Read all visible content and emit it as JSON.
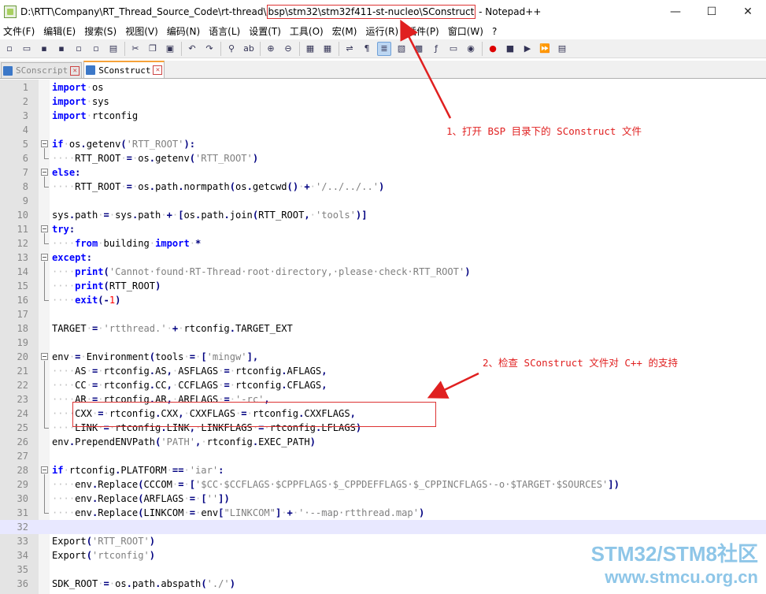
{
  "window": {
    "title_prefix": "D:\\RTT\\Company\\RT_Thread_Source_Code\\rt-thread\\",
    "title_highlight": "bsp\\stm32\\stm32f411-st-nucleo\\SConstruct",
    "title_suffix": " - Notepad++",
    "minimize": "—",
    "maximize": "☐",
    "close": "✕"
  },
  "menu": [
    "文件(F)",
    "编辑(E)",
    "搜索(S)",
    "视图(V)",
    "编码(N)",
    "语言(L)",
    "设置(T)",
    "工具(O)",
    "宏(M)",
    "运行(R)",
    "插件(P)",
    "窗口(W)",
    "?"
  ],
  "tabs": [
    {
      "label": "SConscript",
      "active": false
    },
    {
      "label": "SConstruct",
      "active": true
    }
  ],
  "code_lines": [
    "import os",
    "import sys",
    "import rtconfig",
    "",
    "if os.getenv('RTT_ROOT'):",
    "    RTT_ROOT = os.getenv('RTT_ROOT')",
    "else:",
    "    RTT_ROOT = os.path.normpath(os.getcwd() + '/../../..')",
    "",
    "sys.path = sys.path + [os.path.join(RTT_ROOT, 'tools')]",
    "try:",
    "    from building import *",
    "except:",
    "    print('Cannot found RT-Thread root directory, please check RTT_ROOT')",
    "    print(RTT_ROOT)",
    "    exit(-1)",
    "",
    "TARGET = 'rtthread.' + rtconfig.TARGET_EXT",
    "",
    "env = Environment(tools = ['mingw'],",
    "    AS = rtconfig.AS, ASFLAGS = rtconfig.AFLAGS,",
    "    CC = rtconfig.CC, CCFLAGS = rtconfig.CFLAGS,",
    "    AR = rtconfig.AR, ARFLAGS = '-rc',",
    "    CXX = rtconfig.CXX, CXXFLAGS = rtconfig.CXXFLAGS,",
    "    LINK = rtconfig.LINK, LINKFLAGS = rtconfig.LFLAGS)",
    "env.PrependENVPath('PATH', rtconfig.EXEC_PATH)",
    "",
    "if rtconfig.PLATFORM == 'iar':",
    "    env.Replace(CCCOM = ['$CC $CCFLAGS $CPPFLAGS $_CPPDEFFLAGS $_CPPINCFLAGS -o $TARGET $SOURCES'])",
    "    env.Replace(ARFLAGS = [''])",
    "    env.Replace(LINKCOM = env[\"LINKCOM\"] + ' --map rtthread.map')",
    "",
    "Export('RTT_ROOT')",
    "Export('rtconfig')",
    "",
    "SDK_ROOT = os.path.abspath('./')"
  ],
  "current_line": 32,
  "annotations": {
    "note1": "1、打开 BSP 目录下的 SConstruct 文件",
    "note2": "2、检查 SConstruct 文件对 C++ 的支持"
  },
  "watermark": {
    "line1": "STM32/STM8社区",
    "line2": "www.stmcu.org.cn"
  },
  "colors": {
    "keyword": "#0000ff",
    "string": "#808080",
    "annotation": "#e02020",
    "current_line": "#e8e8ff"
  }
}
